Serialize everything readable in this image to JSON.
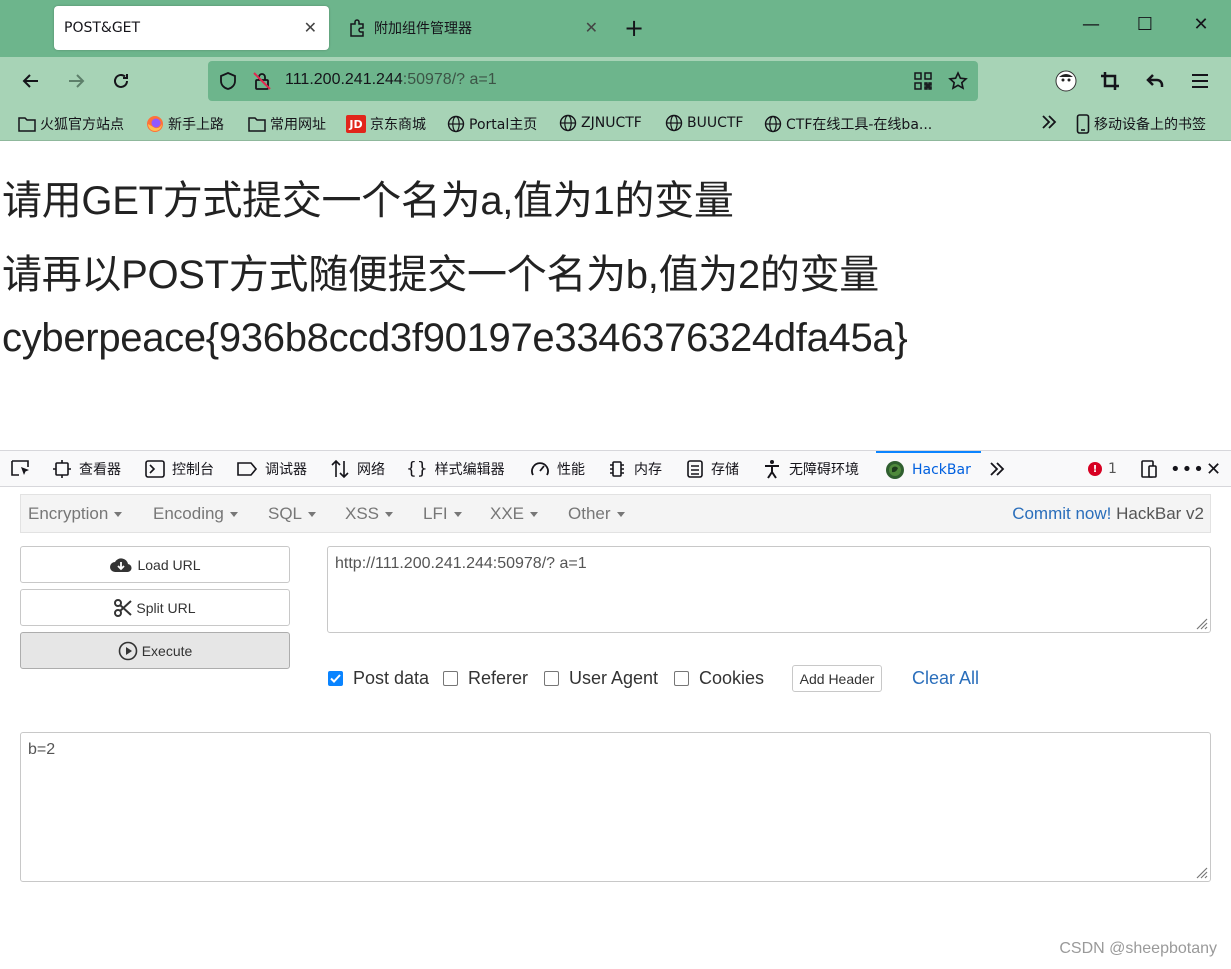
{
  "browser": {
    "tabs": [
      {
        "label": "POST&GET",
        "active": true
      },
      {
        "label": "附加组件管理器",
        "active": false
      }
    ],
    "new_tab_label": "+",
    "url": {
      "host": "111.200.241.244",
      "rest": ":50978/? a=1"
    },
    "bookmarks": [
      {
        "label": "火狐官方站点",
        "icon": "folder-icon"
      },
      {
        "label": "新手上路",
        "icon": "firefox-icon"
      },
      {
        "label": "常用网址",
        "icon": "folder-icon"
      },
      {
        "label": "京东商城",
        "icon": "jd-icon",
        "icon_text": "JD"
      },
      {
        "label": "Portal主页",
        "icon": "globe-icon"
      },
      {
        "label": "ZJNUCTF",
        "icon": "globe-icon"
      },
      {
        "label": "BUUCTF",
        "icon": "globe-icon"
      },
      {
        "label": "CTF在线工具-在线ba...",
        "icon": "globe-icon"
      }
    ],
    "mobile_bookmarks": "移动设备上的书签",
    "colors": {
      "tabbar": "#6db58c",
      "navbar": "#a7d3b6"
    }
  },
  "page": {
    "lines": [
      "请用GET方式提交一个名为a,值为1的变量",
      "请再以POST方式随便提交一个名为b,值为2的变量",
      "cyberpeace{936b8ccd3f90197e3346376324dfa45a}"
    ]
  },
  "devtools": {
    "tabs": [
      "查看器",
      "控制台",
      "调试器",
      "网络",
      "样式编辑器",
      "性能",
      "内存",
      "存储",
      "无障碍环境",
      "HackBar"
    ],
    "active_tab": "HackBar",
    "error_count": "1"
  },
  "hackbar": {
    "menu": [
      "Encryption",
      "Encoding",
      "SQL",
      "XSS",
      "LFI",
      "XXE",
      "Other"
    ],
    "commit_link": "Commit now!",
    "version": "HackBar v2",
    "buttons": {
      "load_url": "Load URL",
      "split_url": "Split URL",
      "execute": "Execute"
    },
    "url_value": "http://111.200.241.244:50978/? a=1",
    "options": [
      {
        "label": "Post data",
        "checked": true
      },
      {
        "label": "Referer",
        "checked": false
      },
      {
        "label": "User Agent",
        "checked": false
      },
      {
        "label": "Cookies",
        "checked": false
      }
    ],
    "add_header": "Add Header",
    "clear_all": "Clear All",
    "post_body": "b=2"
  },
  "watermark": "CSDN @sheepbotany"
}
